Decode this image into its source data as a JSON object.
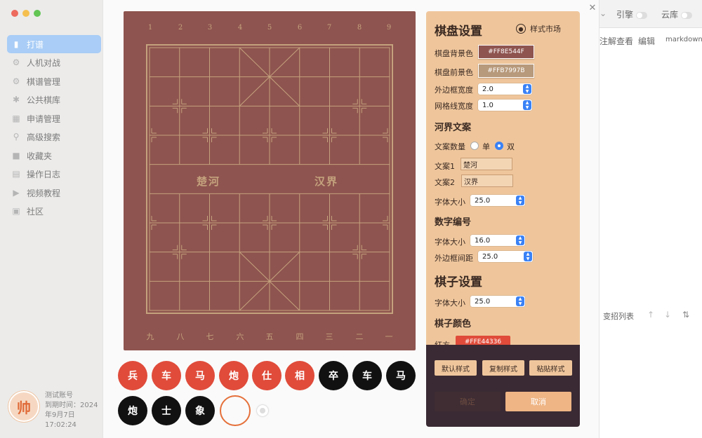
{
  "window": {
    "traffic_colors": [
      "#ed6a5e",
      "#f5bf4f",
      "#62c554"
    ]
  },
  "sidebar": {
    "items": [
      {
        "label": "打谱",
        "icon": "book-icon",
        "active": true
      },
      {
        "label": "人机对战",
        "icon": "robot-icon",
        "active": false
      },
      {
        "label": "棋谱管理",
        "icon": "gear-icon",
        "active": false
      },
      {
        "label": "公共棋库",
        "icon": "asterisk-icon",
        "active": false
      },
      {
        "label": "申请管理",
        "icon": "calendar-icon",
        "active": false
      },
      {
        "label": "高级搜索",
        "icon": "search-icon",
        "active": false
      },
      {
        "label": "收藏夹",
        "icon": "folder-icon",
        "active": false
      },
      {
        "label": "操作日志",
        "icon": "log-icon",
        "active": false
      },
      {
        "label": "视频教程",
        "icon": "play-icon",
        "active": false
      },
      {
        "label": "社区",
        "icon": "chat-icon",
        "active": false
      }
    ]
  },
  "user": {
    "avatar_text": "帅",
    "line1": "测试账号",
    "line2": "到期时间：2024",
    "line3": "年9月7日",
    "line4": "17:02:24"
  },
  "right_panel": {
    "engine_label": "引擎",
    "cloud_label": "云库",
    "tab_view": "注解查看",
    "tab_edit": "编辑",
    "tab_markdown": "markdown",
    "variations_label": "变招列表"
  },
  "board": {
    "bg_color": "#8E544F",
    "line_color": "#C4A27D",
    "top_numbers": [
      "1",
      "2",
      "3",
      "4",
      "5",
      "6",
      "7",
      "8",
      "9"
    ],
    "bottom_numbers": [
      "九",
      "八",
      "七",
      "六",
      "五",
      "四",
      "三",
      "二",
      "一"
    ],
    "river_left": "楚河",
    "river_right": "汉界"
  },
  "pieces": [
    {
      "text": "兵",
      "color": "red"
    },
    {
      "text": "车",
      "color": "red"
    },
    {
      "text": "马",
      "color": "red"
    },
    {
      "text": "炮",
      "color": "red"
    },
    {
      "text": "仕",
      "color": "red"
    },
    {
      "text": "相",
      "color": "red"
    },
    {
      "text": "卒",
      "color": "black"
    },
    {
      "text": "车",
      "color": "black"
    },
    {
      "text": "马",
      "color": "black"
    },
    {
      "text": "炮",
      "color": "black"
    },
    {
      "text": "士",
      "color": "black"
    },
    {
      "text": "象",
      "color": "black"
    }
  ],
  "settings": {
    "title": "棋盘设置",
    "market": "样式市场",
    "bg_color_label": "棋盘背景色",
    "bg_color_value": "#FF8E544F",
    "bg_color_swatch": "#8E544F",
    "fg_color_label": "棋盘前景色",
    "fg_color_value": "#FFB7997B",
    "fg_color_swatch": "#B7997B",
    "border_width_label": "外边框宽度",
    "border_width_value": "2.0",
    "grid_width_label": "网格线宽度",
    "grid_width_value": "1.0",
    "river_section": "河界文案",
    "text_count_label": "文案数量",
    "single_label": "单",
    "double_label": "双",
    "text1_label": "文案1",
    "text1_value": "楚河",
    "text2_label": "文案2",
    "text2_value": "汉界",
    "river_font_label": "字体大小",
    "river_font_value": "25.0",
    "number_section": "数字编号",
    "number_font_label": "字体大小",
    "number_font_value": "16.0",
    "number_margin_label": "外边框间距",
    "number_margin_value": "25.0",
    "piece_title": "棋子设置",
    "piece_font_label": "字体大小",
    "piece_font_value": "25.0",
    "piece_color_section": "棋子颜色",
    "red_label": "红方",
    "red_value": "#FFE44336"
  },
  "actions": {
    "default_style": "默认样式",
    "copy_style": "复制样式",
    "paste_style": "粘贴样式",
    "ok": "确定",
    "cancel": "取消"
  }
}
